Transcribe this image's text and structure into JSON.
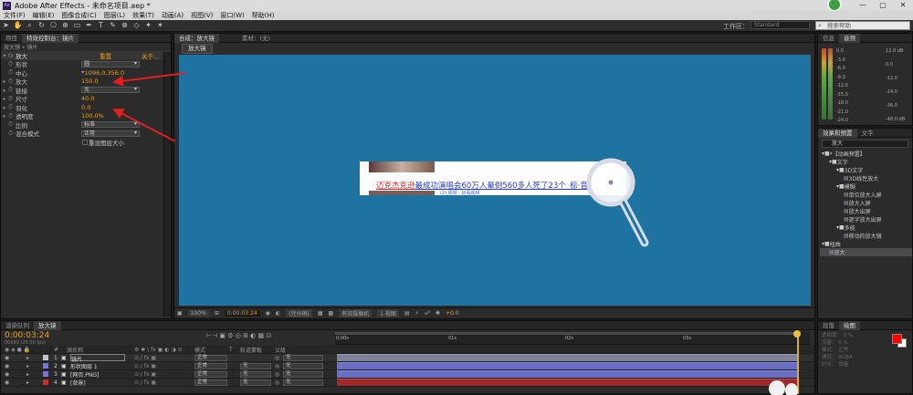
{
  "app": {
    "icon_label": "Ae",
    "title": "Adobe After Effects - 未命名项目.aep *"
  },
  "menu": [
    "文件(F)",
    "编辑(E)",
    "图像合成(C)",
    "图层(L)",
    "效果(T)",
    "动画(A)",
    "视图(V)",
    "窗口(W)",
    "帮助(H)"
  ],
  "toolbar": {
    "workspace_label": "工作区：",
    "workspace_value": "Standard",
    "search_placeholder": "搜索帮助"
  },
  "effect_controls": {
    "tabs": [
      "项目",
      "特效控制台：镜片"
    ],
    "breadcrumb": "放大镜 • 镜片",
    "effect_name": "放大",
    "reset_label": "重置",
    "about_label": "关于...",
    "props": [
      {
        "name": "形状",
        "value": "圆",
        "type": "dropdown",
        "twirl": ""
      },
      {
        "name": "中心",
        "value": "1096.0,356.0",
        "type": "point",
        "twirl": ""
      },
      {
        "name": "放大",
        "value": "150.0",
        "type": "number",
        "twirl": "▸"
      },
      {
        "name": "链接",
        "value": "无",
        "type": "dropdown",
        "twirl": "▸"
      },
      {
        "name": "尺寸",
        "value": "40.0",
        "type": "number",
        "twirl": "▸"
      },
      {
        "name": "羽化",
        "value": "0.0",
        "type": "number",
        "twirl": "▸"
      },
      {
        "name": "透明度",
        "value": "100.0%",
        "type": "number",
        "twirl": "▸"
      },
      {
        "name": "比例",
        "value": "标准",
        "type": "dropdown",
        "twirl": ""
      },
      {
        "name": "混合模式",
        "value": "正常",
        "type": "dropdown",
        "twirl": ""
      },
      {
        "name": "",
        "value": "重设图层大小",
        "type": "checkbox",
        "twirl": ""
      }
    ]
  },
  "composition": {
    "tabs": [
      "合成：放大镜",
      "素材：(无)"
    ],
    "sub_tab": "放大镜",
    "headline_red": "迈克杰克逊",
    "headline_blue": "最成功演唱会60万人晕倒560多人死了23个_标·音",
    "subline": "(2) 视频 · 好看视频",
    "zoom": "100%",
    "timecode": "0:00:03:24",
    "view_mode": "(完分辨)",
    "camera": "有效摄像机",
    "views": "1 视图",
    "exposure": "+0.0"
  },
  "info_panel": {
    "tabs": [
      "信息",
      "音频"
    ],
    "left_scale": [
      "0.0",
      "-3.0",
      "-6.0",
      "-9.0",
      "-12.0",
      "-15.0",
      "-18.0",
      "-21.0",
      "-24.0"
    ],
    "right_scale": [
      "12.0 dB",
      "0.0",
      "-12.0",
      "-24.0",
      "-36.0",
      "-48.0 dB"
    ]
  },
  "effects_panel": {
    "tabs": [
      "效果和预置",
      "文字"
    ],
    "search": "放大",
    "tree": [
      {
        "label": "*【动画预置】",
        "indent": 0,
        "kind": "folder"
      },
      {
        "label": "文字",
        "indent": 1,
        "kind": "folder"
      },
      {
        "label": "3D文字",
        "indent": 2,
        "kind": "folder"
      },
      {
        "label": "3D线性放大",
        "indent": 3,
        "kind": "file"
      },
      {
        "label": "模糊",
        "indent": 2,
        "kind": "folder"
      },
      {
        "label": "单位放大入屏",
        "indent": 3,
        "kind": "file"
      },
      {
        "label": "放大入屏",
        "indent": 3,
        "kind": "file"
      },
      {
        "label": "放大出屏",
        "indent": 3,
        "kind": "file"
      },
      {
        "label": "逐字放大出屏",
        "indent": 3,
        "kind": "file"
      },
      {
        "label": "多能",
        "indent": 2,
        "kind": "folder"
      },
      {
        "label": "移动的放大镜",
        "indent": 3,
        "kind": "file"
      },
      {
        "label": "扭曲",
        "indent": 0,
        "kind": "folder"
      },
      {
        "label": "放大",
        "indent": 1,
        "kind": "file",
        "selected": true
      }
    ]
  },
  "timeline": {
    "tabs": [
      "渲染队列",
      "放大镜"
    ],
    "timecode": "0:00:03:24",
    "fps": "00099 (25.00 fps)",
    "cols": {
      "num": "#",
      "name": "源名称",
      "mode": "模式",
      "t": "T",
      "trkmat": "轨道蒙板",
      "parent": "父级"
    },
    "ruler": [
      "0:00s",
      "01s",
      "02s",
      "03s"
    ],
    "layers": [
      {
        "num": "1",
        "name": "镜片",
        "mode": "正常",
        "trkmat": "",
        "parent": "无",
        "color": "#c5c5c5",
        "bar": "#7d8296"
      },
      {
        "num": "2",
        "name": "形状图层 1",
        "mode": "正常",
        "trkmat": "无",
        "parent": "无",
        "color": "#7676d8",
        "bar": "#6a6ec4"
      },
      {
        "num": "3",
        "name": "[网页.PNG]",
        "mode": "正常",
        "trkmat": "无",
        "parent": "无",
        "color": "#7676d8",
        "bar": "#6a6ec4"
      },
      {
        "num": "4",
        "name": "[背景]",
        "mode": "正常",
        "trkmat": "无",
        "parent": "无",
        "color": "#c9302b",
        "bar": "#a02828"
      }
    ]
  },
  "paint_panel": {
    "tabs": [
      "段落",
      "绘图"
    ],
    "opacity_label": "透明度：",
    "opacity_value": "0 %",
    "flow_label": "流量：",
    "flow_value": "0 %",
    "mode_label": "模式：",
    "mode_value": "正常",
    "channel_label": "通道：",
    "channel_value": "RGBA",
    "duration_label": "时长：",
    "duration_value": "常量",
    "fg_color": "#ff0000",
    "bg_color": "#ffffff"
  }
}
